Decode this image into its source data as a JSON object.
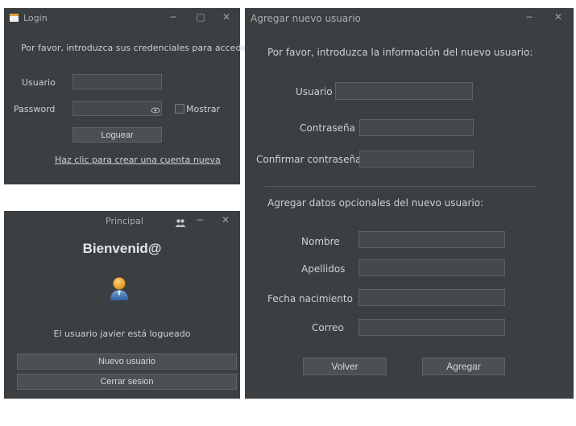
{
  "login": {
    "title": "Login",
    "prompt": "Por favor, introduzca sus credenciales para acceder:",
    "user_label": "Usuario",
    "user_value": "",
    "password_label": "Password",
    "password_value": "",
    "show_label": "Mostrar",
    "login_button": "Loguear",
    "create_link": "Haz clic para crear una cuenta nueva"
  },
  "principal": {
    "title": "Principal",
    "welcome": "Bienvenid@",
    "status": "El usuario javier está logueado",
    "new_user_button": "Nuevo usuario",
    "logout_button": "Cerrar sesion"
  },
  "add_user": {
    "title": "Agregar nuevo usuario",
    "prompt": "Por favor, introduzca la información del nuevo usuario:",
    "user_label": "Usuario",
    "password_label": "Contraseña",
    "confirm_label": "Confirmar contraseña",
    "optional_header": "Agregar datos opcionales del nuevo usuario:",
    "name_label": "Nombre",
    "surname_label": "Apellidos",
    "birth_label": "Fecha nacimiento",
    "email_label": "Correo",
    "back_button": "Volver",
    "add_button": "Agregar"
  },
  "window_controls": {
    "minimize": "−",
    "maximize": "□",
    "close": "✕"
  },
  "colors": {
    "window_bg": "#3c3f41",
    "field_bg": "#46494b",
    "button_bg": "#4c5052"
  }
}
